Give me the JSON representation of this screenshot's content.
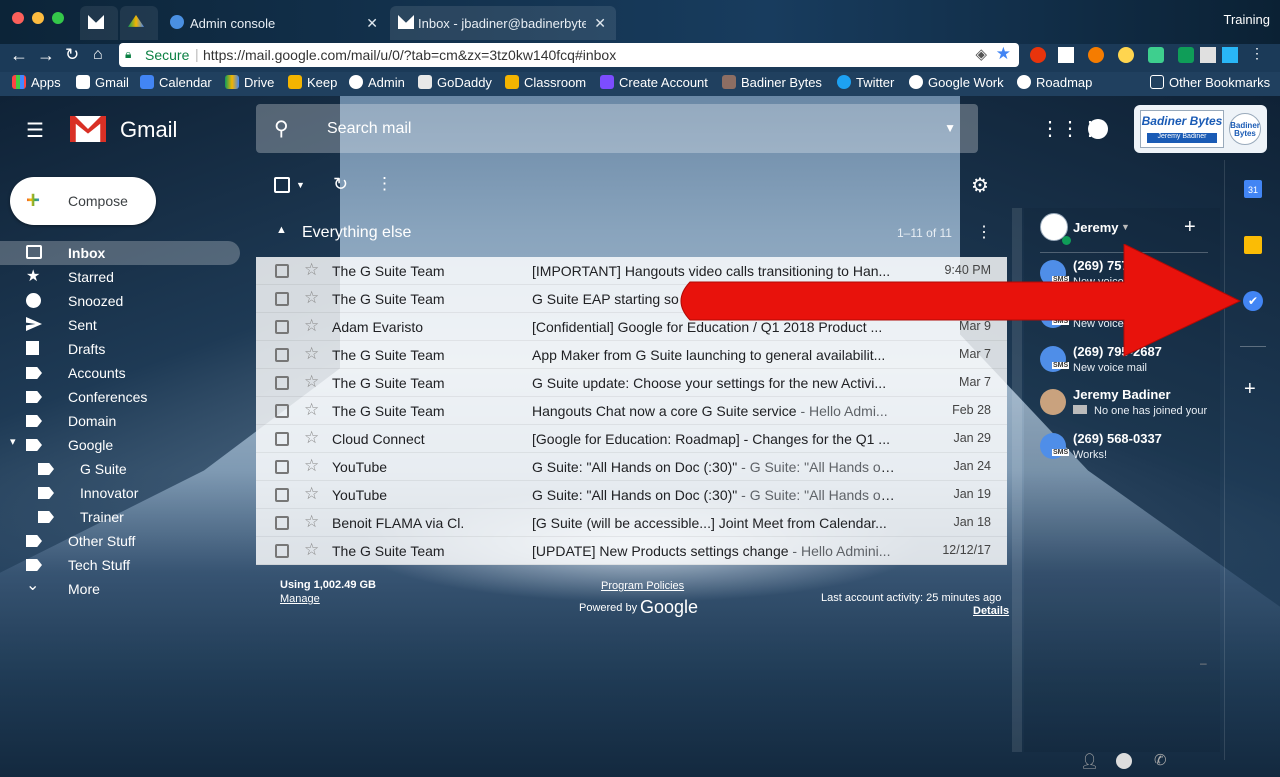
{
  "browser": {
    "profile": "Training",
    "tabs": [
      {
        "label": ""
      },
      {
        "label": ""
      },
      {
        "label": "Admin console"
      },
      {
        "label": "Inbox - jbadiner@badinerbytes"
      }
    ],
    "secure_label": "Secure",
    "url": "https://mail.google.com/mail/u/0/?tab=cm&zx=3tz0kw140fcq#inbox",
    "bookmarks": [
      "Apps",
      "Gmail",
      "Calendar",
      "Drive",
      "Keep",
      "Admin",
      "GoDaddy",
      "Classroom",
      "Create Account",
      "Badiner Bytes",
      "Twitter",
      "Google Work",
      "Roadmap"
    ],
    "other_bookmarks": "Other Bookmarks"
  },
  "gmail": {
    "logo": "Gmail",
    "search_placeholder": "Search mail",
    "compose": "Compose",
    "brand_line1": "Badiner Bytes",
    "brand_line2": "Jeremy Badiner",
    "brand_small": "Badiner Bytes"
  },
  "nav": [
    {
      "label": "Inbox",
      "active": true
    },
    {
      "label": "Starred"
    },
    {
      "label": "Snoozed"
    },
    {
      "label": "Sent"
    },
    {
      "label": "Drafts"
    },
    {
      "label": "Accounts"
    },
    {
      "label": "Conferences"
    },
    {
      "label": "Domain"
    },
    {
      "label": "Google"
    },
    {
      "label": "G Suite"
    },
    {
      "label": "Innovator"
    },
    {
      "label": "Trainer"
    },
    {
      "label": "Other Stuff"
    },
    {
      "label": "Tech Stuff"
    },
    {
      "label": "More"
    }
  ],
  "list": {
    "section": "Everything else",
    "count": "1–11 of 11",
    "rows": [
      {
        "from": "The G Suite Team",
        "subject": "[IMPORTANT] Hangouts video calls transitioning to Han...",
        "snippet": "",
        "date": "9:40 PM"
      },
      {
        "from": "The G Suite Team",
        "subject": "G Suite EAP starting so",
        "snippet": "",
        "date": ""
      },
      {
        "from": "Adam Evaristo",
        "subject": "[Confidential] Google for Education / Q1 2018 Product ...",
        "snippet": "",
        "date": "Mar 9"
      },
      {
        "from": "The G Suite Team",
        "subject": "App Maker from G Suite launching to general availabilit...",
        "snippet": "",
        "date": "Mar 7"
      },
      {
        "from": "The G Suite Team",
        "subject": "G Suite update: Choose your settings for the new Activi...",
        "snippet": "",
        "date": "Mar 7"
      },
      {
        "from": "The G Suite Team",
        "subject": "Hangouts Chat now a core G Suite service",
        "snippet": " - Hello Admi...",
        "date": "Feb 28"
      },
      {
        "from": "Cloud Connect",
        "subject": "[Google for Education: Roadmap] - Changes for the Q1 ...",
        "snippet": "",
        "date": "Jan 29"
      },
      {
        "from": "YouTube",
        "subject": "G Suite: \"All Hands on Doc (:30)\"",
        "snippet": " - G Suite: \"All Hands on...",
        "date": "Jan 24"
      },
      {
        "from": "YouTube",
        "subject": "G Suite: \"All Hands on Doc (:30)\"",
        "snippet": " - G Suite: \"All Hands on...",
        "date": "Jan 19"
      },
      {
        "from": "Benoit FLAMA via Cl.",
        "subject": "[G Suite (will be accessible...] Joint Meet from Calendar...",
        "snippet": "",
        "date": "Jan 18"
      },
      {
        "from": "The G Suite Team",
        "subject": "[UPDATE] New Products settings change",
        "snippet": " - Hello Admini...",
        "date": "12/12/17"
      }
    ]
  },
  "footer": {
    "storage": "Using 1,002.49 GB",
    "manage": "Manage",
    "policies": "Program Policies",
    "powered": "Powered by",
    "google": "Google",
    "activity": "Last account activity: 25 minutes ago",
    "details": "Details"
  },
  "hangouts": {
    "me": "Jeremy",
    "contacts": [
      {
        "name": "(269) 757-2...",
        "status": "New voice mail"
      },
      {
        "name": "",
        "status": "New voice mail"
      },
      {
        "name": "(269) 795-2687",
        "status": "New voice mail"
      },
      {
        "name": "Jeremy Badiner",
        "status": "No one has joined your"
      },
      {
        "name": "(269) 568-0337",
        "status": "Works!"
      }
    ],
    "sms": "SMS"
  },
  "rail": {
    "calendar_day": "31"
  },
  "colors": {
    "arrow": "#e8120c",
    "compose_bg": "#ffffff",
    "active_nav": "rgba(255,255,255,0.25)"
  }
}
